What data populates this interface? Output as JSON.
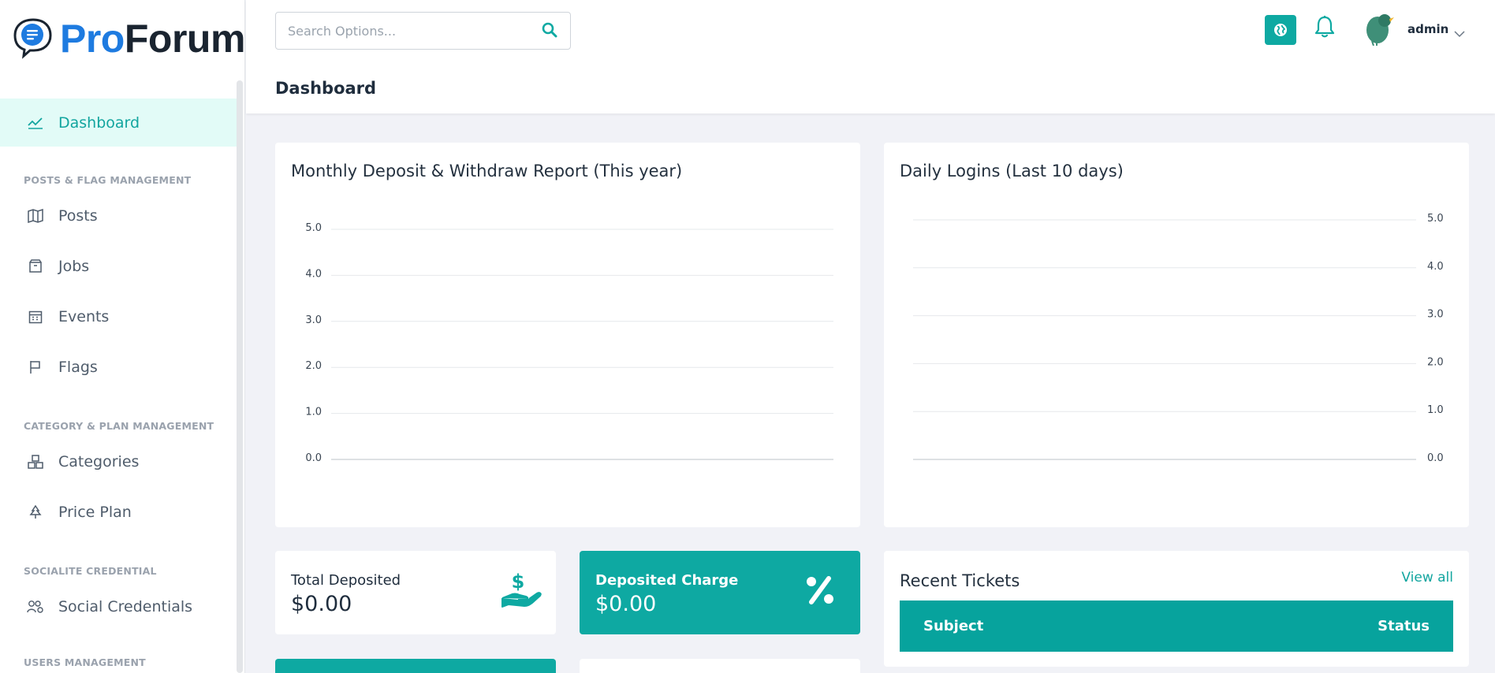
{
  "brand": {
    "pro": "Pro",
    "forum": "Forum"
  },
  "search": {
    "placeholder": "Search Options..."
  },
  "user": {
    "name": "admin"
  },
  "page": {
    "title": "Dashboard"
  },
  "sidebar": {
    "dashboard": "Dashboard",
    "sections": {
      "posts_flag": "POSTS & FLAG MANAGEMENT",
      "category_plan": "CATEGORY & PLAN MANAGEMENT",
      "socialite": "SOCIALITE CREDENTIAL",
      "users": "USERS MANAGEMENT"
    },
    "items": {
      "posts": "Posts",
      "jobs": "Jobs",
      "events": "Events",
      "flags": "Flags",
      "categories": "Categories",
      "price_plan": "Price Plan",
      "social_credentials": "Social Credentials"
    }
  },
  "charts": {
    "deposit": {
      "title": "Monthly Deposit & Withdraw Report (This year)"
    },
    "logins": {
      "title": "Daily Logins (Last 10 days)"
    }
  },
  "chart_data": [
    {
      "type": "line",
      "title": "Monthly Deposit & Withdraw Report (This year)",
      "ylim": [
        0,
        5
      ],
      "y_ticks": [
        "0.0",
        "1.0",
        "2.0",
        "3.0",
        "4.0",
        "5.0"
      ],
      "y_axis_side": "left",
      "grid": true,
      "series": []
    },
    {
      "type": "line",
      "title": "Daily Logins (Last 10 days)",
      "ylim": [
        0,
        5
      ],
      "y_ticks": [
        "0.0",
        "1.0",
        "2.0",
        "3.0",
        "4.0",
        "5.0"
      ],
      "y_axis_side": "right",
      "grid": true,
      "series": []
    }
  ],
  "stats": {
    "total_deposited": {
      "label": "Total Deposited",
      "value": "$0.00"
    },
    "deposited_charge": {
      "label": "Deposited Charge",
      "value": "$0.00"
    }
  },
  "tickets": {
    "title": "Recent Tickets",
    "view_all": "View all",
    "columns": [
      "Subject",
      "Status"
    ]
  },
  "colors": {
    "accent": "#0ea9a2",
    "brand_blue": "#1e7be0",
    "active_bg": "#e2fbf7"
  },
  "icons": {
    "logo": "chat-bubble-icon",
    "search": "search-icon",
    "globe": "globe-icon",
    "bell": "bell-icon",
    "deposit": "hand-dollar-icon",
    "charge": "percent-icon"
  }
}
